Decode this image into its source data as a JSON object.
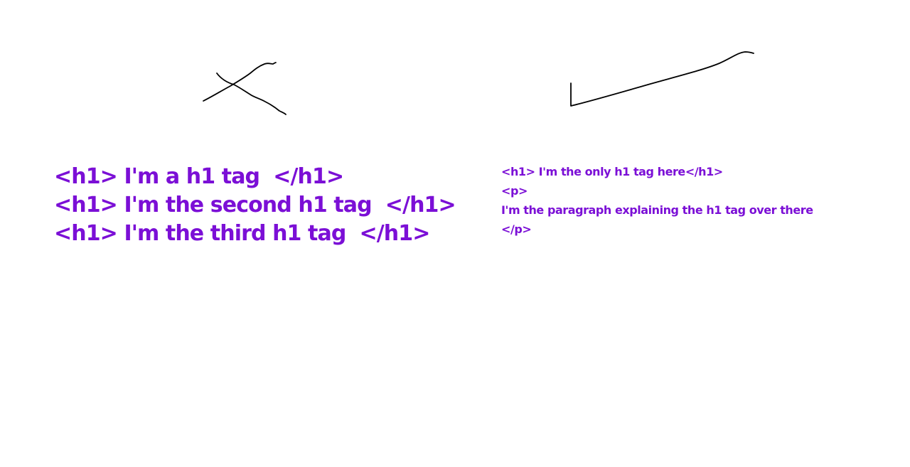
{
  "colors": {
    "text": "#7b0fd6",
    "ink": "#000000",
    "background": "#ffffff"
  },
  "left_panel": {
    "mark": "cross-mark",
    "lines": [
      "<h1> I'm a h1 tag  </h1>",
      "<h1> I'm the second h1 tag  </h1>",
      "<h1> I'm the third h1 tag  </h1>"
    ]
  },
  "right_panel": {
    "mark": "check-mark",
    "lines": [
      "<h1> I'm the only h1 tag here</h1>",
      "<p>",
      "I'm the paragraph explaining the h1 tag over there",
      "</p>"
    ]
  }
}
